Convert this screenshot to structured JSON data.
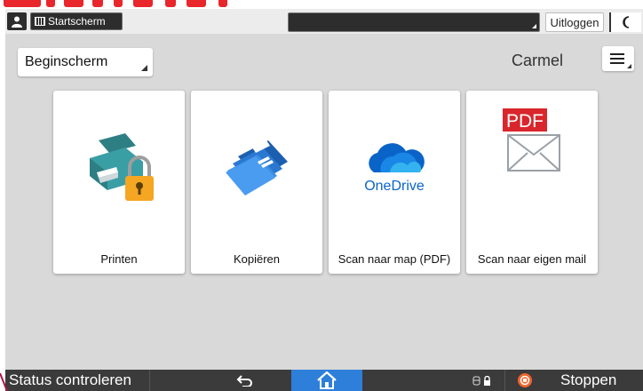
{
  "topbar": {
    "start_label": "Startscherm",
    "logout_label": "Uitloggen",
    "user_icon": "user-icon",
    "moon_icon": "moon-icon"
  },
  "home": {
    "screen_select": "Beginscherm",
    "username": "Carmel",
    "menu_icon": "menu-icon"
  },
  "apps": [
    {
      "label": "Printen",
      "icon": "printer-lock-icon"
    },
    {
      "label": "Kopiëren",
      "icon": "copy-icon"
    },
    {
      "label": "Scan naar map (PDF)",
      "icon": "onedrive-icon",
      "icon_text": "OneDrive"
    },
    {
      "label": "Scan naar eigen mail",
      "icon": "pdf-mail-icon",
      "icon_text": "PDF"
    }
  ],
  "bottombar": {
    "status_label": "Status controleren",
    "stop_label": "Stoppen",
    "back_icon": "back-icon",
    "home_icon": "home-icon"
  },
  "colors": {
    "accent_blue": "#2e7fd9",
    "stop_orange": "#f2652a",
    "pdf_red": "#d9262c",
    "brand_red": "#e8262b"
  }
}
